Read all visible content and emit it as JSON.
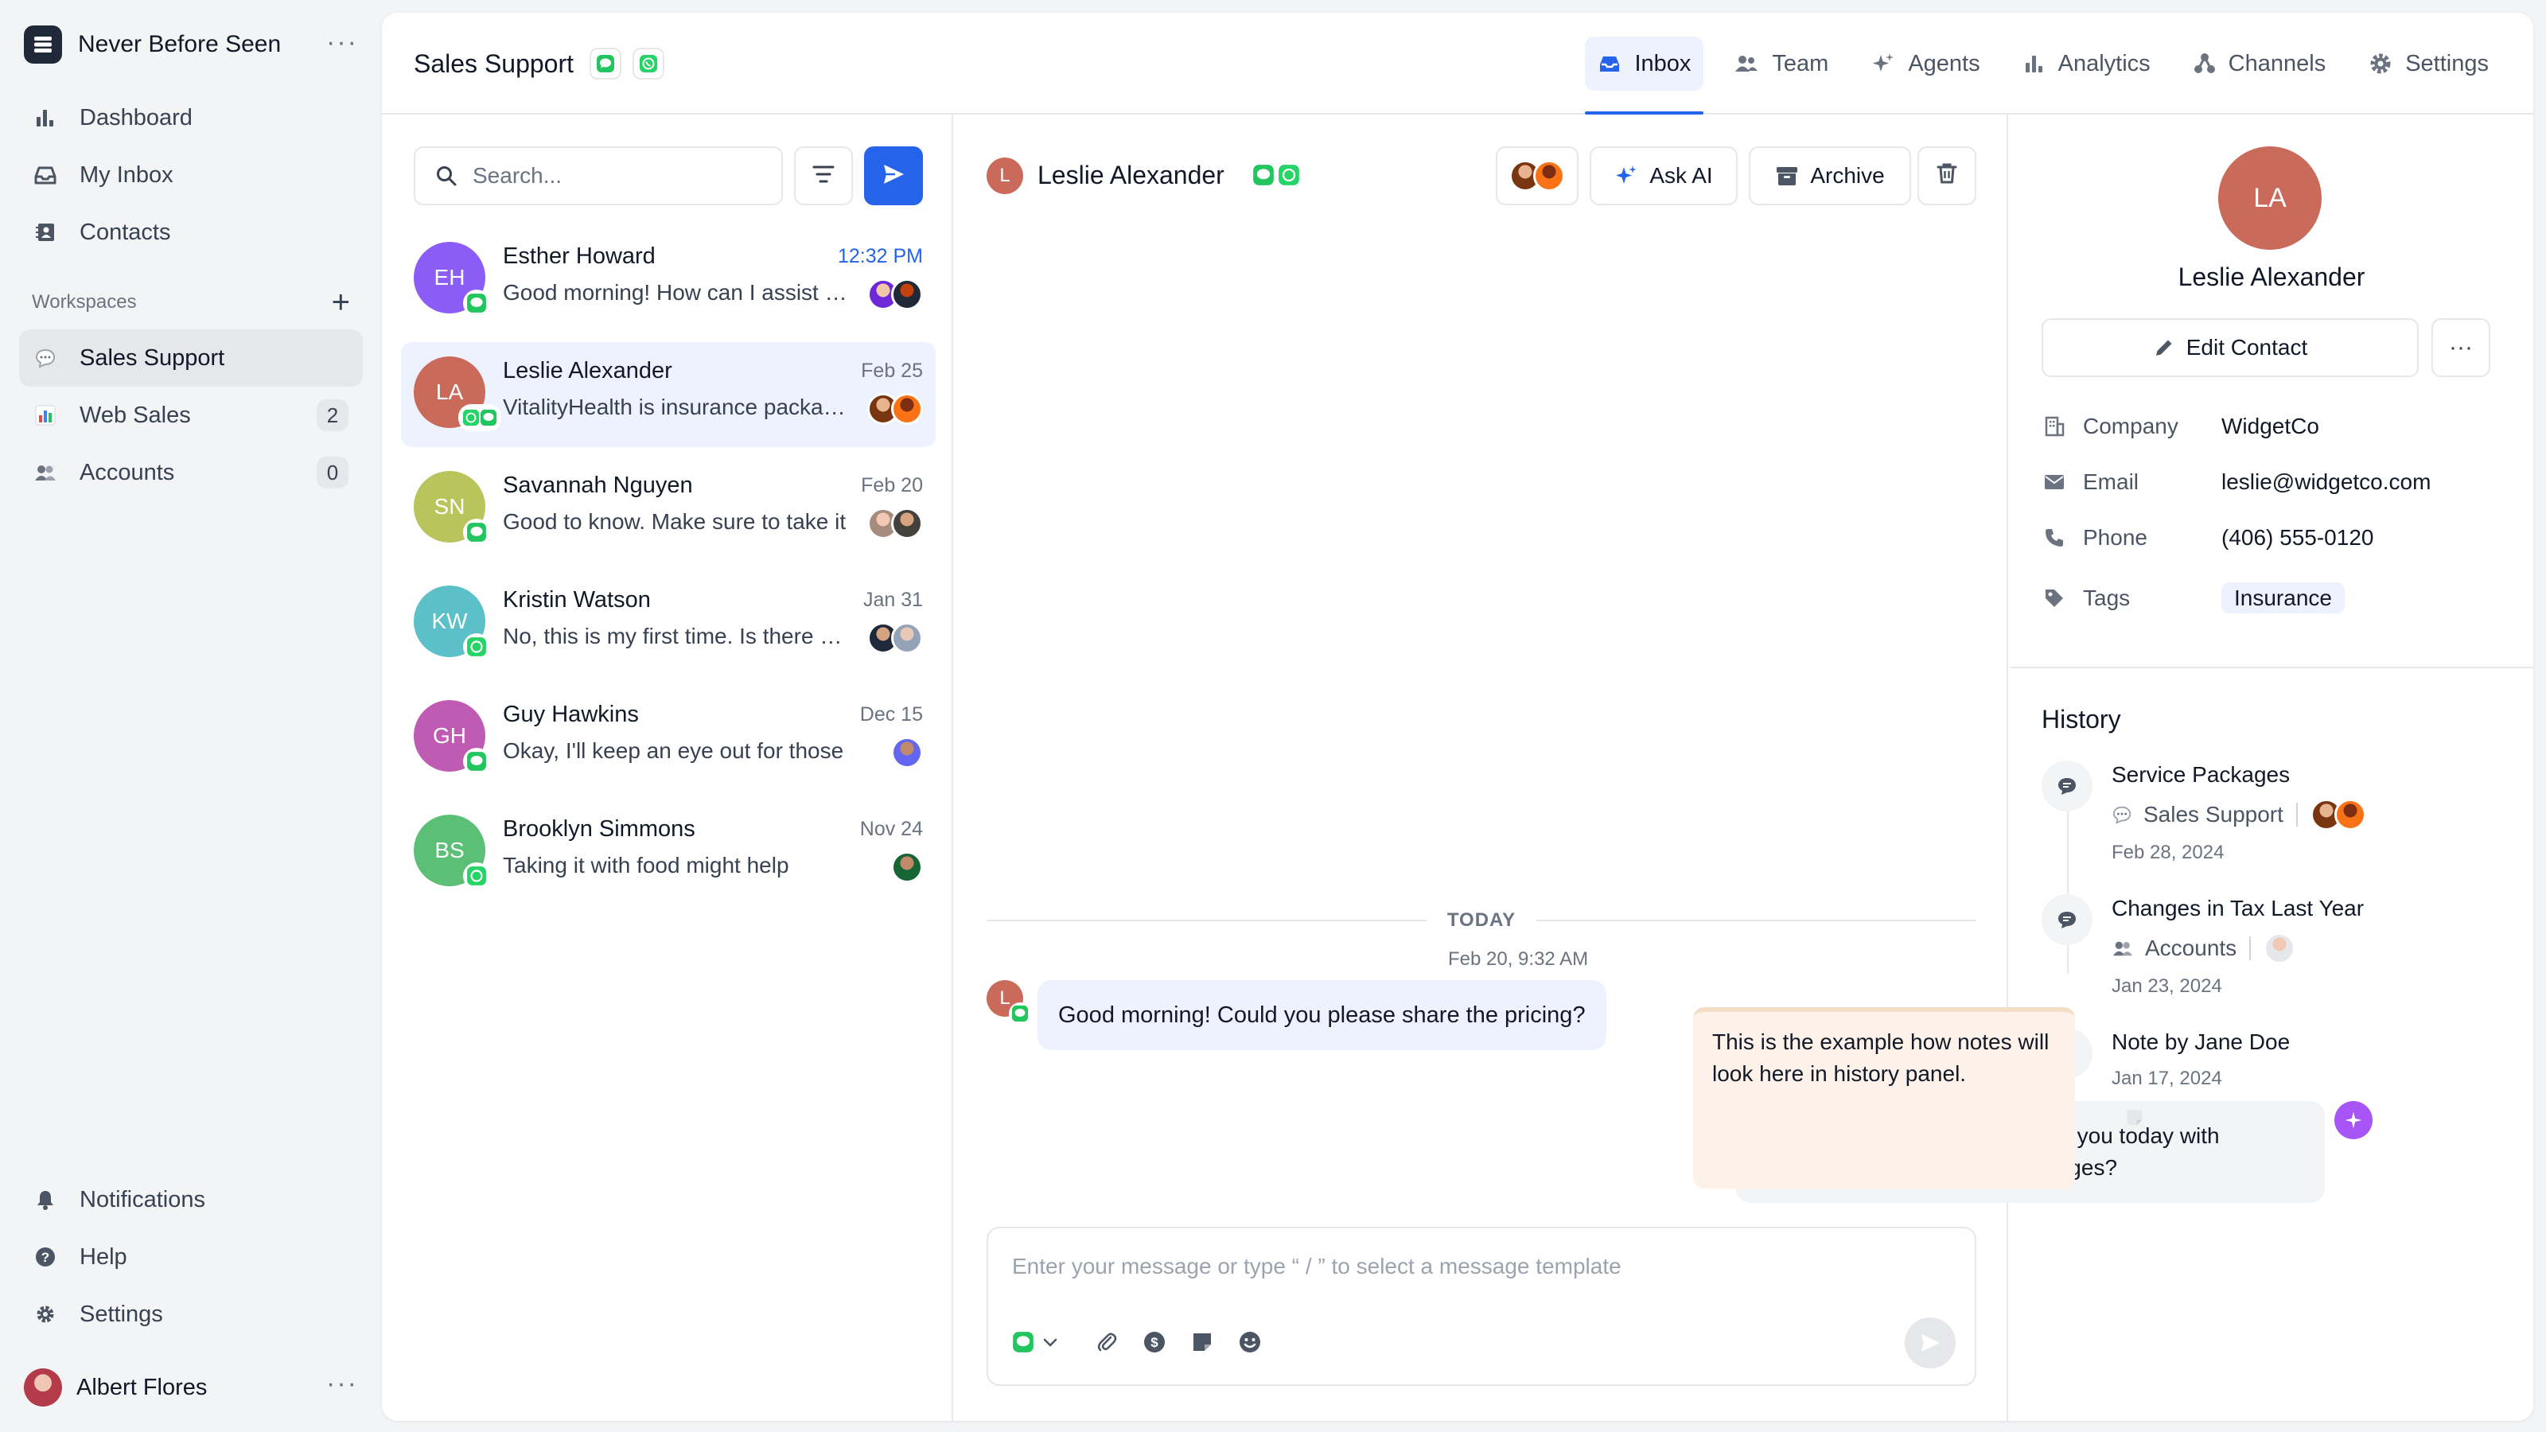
{
  "org": {
    "name": "Never Before Seen"
  },
  "nav": [
    {
      "label": "Dashboard"
    },
    {
      "label": "My Inbox"
    },
    {
      "label": "Contacts"
    }
  ],
  "workspaces": {
    "heading": "Workspaces",
    "items": [
      {
        "label": "Sales Support",
        "count": ""
      },
      {
        "label": "Web Sales",
        "count": "2"
      },
      {
        "label": "Accounts",
        "count": "0"
      }
    ]
  },
  "bottom_nav": [
    {
      "label": "Notifications"
    },
    {
      "label": "Help"
    },
    {
      "label": "Settings"
    }
  ],
  "user": {
    "name": "Albert Flores"
  },
  "header": {
    "title": "Sales Support",
    "tabs": [
      {
        "label": "Inbox",
        "icon": "inbox-icon"
      },
      {
        "label": "Team",
        "icon": "team-icon"
      },
      {
        "label": "Agents",
        "icon": "sparkle-icon"
      },
      {
        "label": "Analytics",
        "icon": "analytics-icon"
      },
      {
        "label": "Channels",
        "icon": "channels-icon"
      },
      {
        "label": "Settings",
        "icon": "gear-icon"
      }
    ]
  },
  "search": {
    "placeholder": "Search..."
  },
  "conversations": [
    {
      "initials": "EH",
      "name": "Esther Howard",
      "time": "12:32 PM",
      "preview": "Good morning! How can I assist you today?",
      "color": "#8b5cf6"
    },
    {
      "initials": "LA",
      "name": "Leslie Alexander",
      "time": "Feb 25",
      "preview": "VitalityHealth is insurance packages",
      "color": "#c96a5a"
    },
    {
      "initials": "SN",
      "name": "Savannah Nguyen",
      "time": "Feb 20",
      "preview": "Good to know. Make sure to take it",
      "color": "#b9c45b"
    },
    {
      "initials": "KW",
      "name": "Kristin Watson",
      "time": "Jan 31",
      "preview": "No, this is my first time. Is there anything",
      "color": "#5bc0c7"
    },
    {
      "initials": "GH",
      "name": "Guy Hawkins",
      "time": "Dec 15",
      "preview": "Okay, I'll keep an eye out for those",
      "color": "#c05bb3"
    },
    {
      "initials": "BS",
      "name": "Brooklyn Simmons",
      "time": "Nov 24",
      "preview": "Taking it with food might help",
      "color": "#5bbf75"
    }
  ],
  "chat": {
    "contact_initial": "L",
    "contact_name": "Leslie Alexander",
    "ask_ai": "Ask AI",
    "archive": "Archive",
    "today_label": "TODAY",
    "msg_time": "Feb 20, 9:32 AM",
    "incoming": "Good morning! Could you please share the pricing?",
    "outgoing": "Good morning! How can I assist you today with VitalityHealth’s insurance packages?",
    "composer_placeholder": "Enter your message or type “ / ” to select a message template"
  },
  "contact": {
    "initials": "LA",
    "name": "Leslie Alexander",
    "edit_label": "Edit Contact",
    "fields": [
      {
        "key": "Company",
        "value": "WidgetCo"
      },
      {
        "key": "Email",
        "value": "leslie@widgetco.com"
      },
      {
        "key": "Phone",
        "value": "(406) 555-0120"
      },
      {
        "key": "Tags",
        "value": "Insurance"
      }
    ]
  },
  "history": {
    "title": "History",
    "items": [
      {
        "title": "Service Packages",
        "workspace": "Sales Support",
        "date": "Feb 28, 2024"
      },
      {
        "title": "Changes in Tax Last Year",
        "workspace": "Accounts",
        "date": "Jan 23, 2024"
      },
      {
        "title": "Note by Jane Doe",
        "date": "Jan 17, 2024"
      }
    ],
    "note": "This is the example how notes will look here in history panel."
  },
  "colors": {
    "accent": "#2563eb",
    "chat_green": "#22c55e",
    "whatsapp": "#25d366",
    "ai_purple": "#a855f7"
  }
}
